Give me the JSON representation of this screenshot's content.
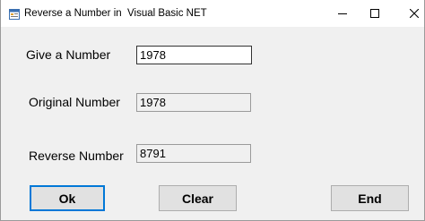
{
  "window": {
    "title": "Reverse a Number in  Visual Basic NET",
    "icon": "form-icon",
    "controls": {
      "minimize_icon": "minimize-icon",
      "maximize_icon": "maximize-icon",
      "close_icon": "close-icon"
    }
  },
  "form": {
    "input_label": "Give a Number",
    "input_value": "1978",
    "original_label": "Original Number",
    "original_value": "1978",
    "reverse_label": "Reverse Number",
    "reverse_value": "8791"
  },
  "buttons": {
    "ok_label": "Ok",
    "clear_label": "Clear",
    "end_label": "End"
  },
  "colors": {
    "accent": "#0078d7",
    "form_background": "#f0f0f0"
  }
}
